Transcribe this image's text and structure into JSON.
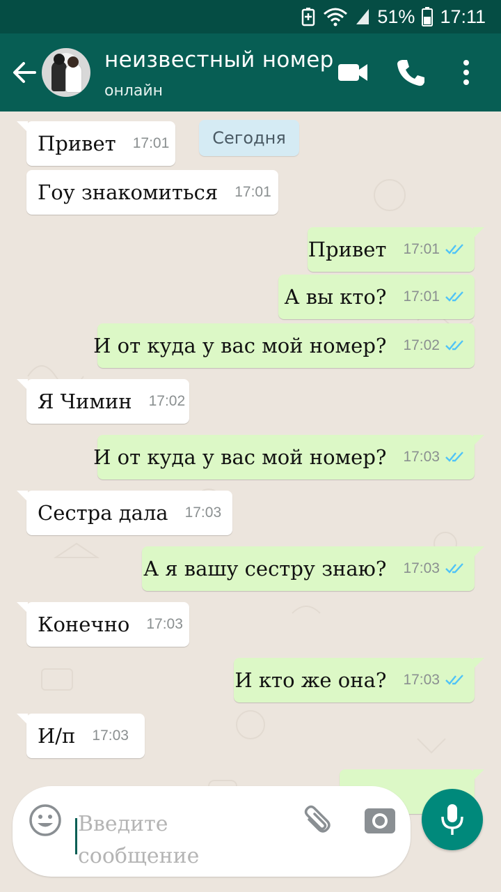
{
  "status_bar": {
    "battery": "51%",
    "time": "17:11"
  },
  "header": {
    "contact_name": "неизвестный номер",
    "contact_status": "онлайн",
    "icons": [
      "back-arrow-icon",
      "video-call-icon",
      "phone-icon",
      "more-vert-icon"
    ]
  },
  "chat": {
    "date_label": "Сегодня",
    "messages": [
      {
        "dir": "in",
        "text": "Привет",
        "time": "17:01"
      },
      {
        "dir": "in",
        "text": "Гоу знакомиться",
        "time": "17:01"
      },
      {
        "dir": "out",
        "text": "Привет",
        "time": "17:01",
        "status": "read"
      },
      {
        "dir": "out",
        "text": "А вы кто?",
        "time": "17:01",
        "status": "read"
      },
      {
        "dir": "out",
        "text": "И от куда у вас мой номер?",
        "time": "17:02",
        "status": "read"
      },
      {
        "dir": "in",
        "text": "Я Чимин",
        "time": "17:02"
      },
      {
        "dir": "out",
        "text": "И от куда у вас мой номер?",
        "time": "17:03",
        "status": "read"
      },
      {
        "dir": "in",
        "text": "Сестра дала",
        "time": "17:03"
      },
      {
        "dir": "out",
        "text": "А я вашу сестру знаю?",
        "time": "17:03",
        "status": "read"
      },
      {
        "dir": "in",
        "text": "Конечно",
        "time": "17:03"
      },
      {
        "dir": "out",
        "text": "И кто же она?",
        "time": "17:03",
        "status": "read"
      },
      {
        "dir": "in",
        "text": "И/п",
        "time": "17:03"
      }
    ]
  },
  "composer": {
    "placeholder": "Введите сообщение",
    "icons": [
      "emoji-icon",
      "paperclip-icon",
      "camera-icon",
      "microphone-icon"
    ]
  },
  "colors": {
    "status_bar": "#054d44",
    "app_bar": "#075e54",
    "chat_background": "#ece5dd",
    "incoming_bubble": "#ffffff",
    "outgoing_bubble": "#dcf8c6",
    "read_ticks": "#4fc3f7",
    "mic_button": "#00897b"
  }
}
